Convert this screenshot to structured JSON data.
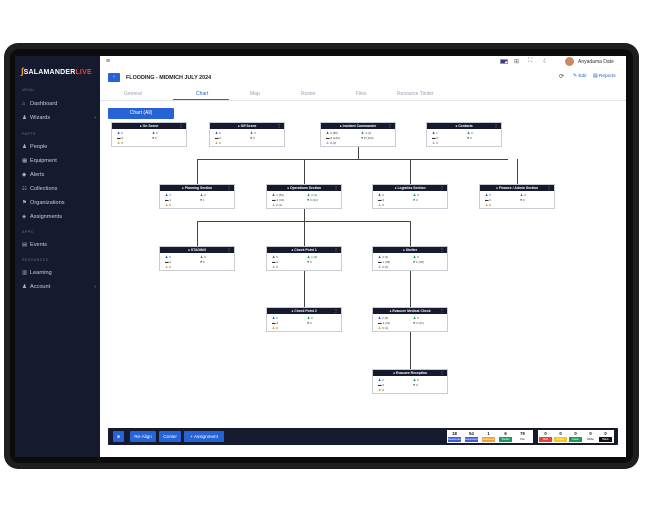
{
  "app": {
    "logo_text": "SALAMANDER",
    "logo_live": "LIVE",
    "logo_flame": "∫"
  },
  "sidebar": {
    "sections": [
      "MENU",
      "PARTS",
      "APPS",
      "RESOURCES"
    ],
    "items": [
      {
        "label": "Dashboard",
        "icon": "home-icon",
        "glyph": "⌂"
      },
      {
        "label": "Wizards",
        "icon": "person-icon",
        "glyph": "♟",
        "chevron": "›"
      },
      {
        "label": "People",
        "icon": "person-icon",
        "glyph": "♟"
      },
      {
        "label": "Equipment",
        "icon": "truck-icon",
        "glyph": "▦"
      },
      {
        "label": "Alerts",
        "icon": "bell-icon",
        "glyph": "◆"
      },
      {
        "label": "Collections",
        "icon": "group-icon",
        "glyph": "☷"
      },
      {
        "label": "Organizations",
        "icon": "flag-icon",
        "glyph": "⚑"
      },
      {
        "label": "Assignments",
        "icon": "tag-icon",
        "glyph": "◈"
      },
      {
        "label": "Events",
        "icon": "calendar-icon",
        "glyph": "▤"
      },
      {
        "label": "Learning",
        "icon": "book-icon",
        "glyph": "▥"
      },
      {
        "label": "Account",
        "icon": "user-group-icon",
        "glyph": "♟",
        "chevron": "›"
      }
    ]
  },
  "topbar": {
    "hamburger": "≡",
    "user_name": "Anyadama Date",
    "icons": [
      "flag-icon",
      "grid-icon",
      "expand-icon",
      "moon-icon"
    ],
    "icon_glyphs": [
      "⊞",
      "⛶",
      "☾"
    ]
  },
  "header": {
    "back": "‹",
    "incident_title": "FLOODING - MIDMICH JULY 2024",
    "refresh_glyph": "⟳",
    "edit_label": "Edit",
    "reports_label": "Reports"
  },
  "tabs": [
    "General",
    "Chart",
    "Map",
    "Roster",
    "Files",
    "Resource Tinder"
  ],
  "active_tab": "Chart",
  "chart_all_label": "Chart (All)",
  "nodes": [
    {
      "title": "On Scene",
      "p": "0",
      "g": "0",
      "d": "0",
      "o": "0"
    },
    {
      "title": "Off Scene",
      "p": "0",
      "g": "0",
      "d": "0",
      "o": "0"
    },
    {
      "title": "Incident Commander",
      "p": "6 (80)",
      "g": "4 (1)",
      "d": "8 (164)",
      "o": "0 (0)"
    },
    {
      "title": "Contacts",
      "p": "1",
      "g": "0",
      "d": "0",
      "o": "0"
    },
    {
      "title": "Planning Section",
      "p": "1",
      "g": "0",
      "d": "1",
      "o": "0"
    },
    {
      "title": "Operations Section",
      "p": "1 (84)",
      "g": "3 (1)",
      "d": "3 (31)",
      "o": "0 (1)"
    },
    {
      "title": "Logistics Section",
      "p": "3",
      "g": "0",
      "d": "3",
      "o": "0"
    },
    {
      "title": "Finance / Admin Section",
      "p": "0",
      "g": "0",
      "d": "0",
      "o": "0"
    },
    {
      "title": "STAGING",
      "p": "0",
      "g": "0",
      "d": "0",
      "o": "0"
    },
    {
      "title": "Check Point 1",
      "p": "6",
      "g": "1 (4)",
      "d": "0",
      "o": "0"
    },
    {
      "title": "Shelter",
      "p": "4 (4)",
      "g": "0",
      "d": "1 (38)",
      "o": "0 (0)"
    },
    {
      "title": "Check Point 2",
      "p": "3",
      "g": "0",
      "d": "3",
      "o": "0"
    },
    {
      "title": "Evacuee Medical Check",
      "p": "2 (8)",
      "g": "0",
      "d": "3 (31)",
      "o": "0 (1)"
    },
    {
      "title": "Evacuee Reception",
      "p": "2",
      "g": "0",
      "d": "0",
      "o": "0"
    }
  ],
  "bottom": {
    "zoom_glyph": "⊕",
    "realign_label": "Re-Align",
    "center_label": "Center",
    "assignment_label": "+ Assignment",
    "stats": [
      {
        "value": "18",
        "label": "Responder",
        "color": "#3b5bdb"
      },
      {
        "value": "54",
        "label": "Equipment",
        "color": "#3b5bdb"
      },
      {
        "value": "1",
        "label": "Evacuees",
        "color": "#f0a030"
      },
      {
        "value": "6",
        "label": "Shelter",
        "color": "#1b9a5b"
      },
      {
        "value": "79",
        "label": "Pax",
        "color": "#ffffff",
        "text_color": "#111"
      }
    ],
    "statuses": [
      {
        "value": "0",
        "label": "Red",
        "color": "#e8423b"
      },
      {
        "value": "0",
        "label": "Amber",
        "color": "#f3c623"
      },
      {
        "value": "0",
        "label": "Green",
        "color": "#1b9a5b"
      },
      {
        "value": "0",
        "label": "White",
        "color": "#ffffff",
        "text_color": "#111"
      },
      {
        "value": "0",
        "label": "Black",
        "color": "#111111"
      }
    ]
  }
}
